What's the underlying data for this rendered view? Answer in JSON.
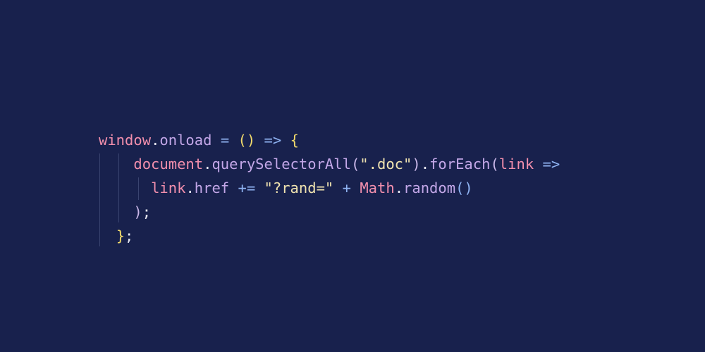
{
  "theme": {
    "background": "#18214d",
    "guide": "#3a4470"
  },
  "code": {
    "lines": [
      [
        {
          "t": "window",
          "c": "var"
        },
        {
          "t": ".",
          "c": "dot"
        },
        {
          "t": "onload",
          "c": "prop"
        },
        {
          "t": " ",
          "c": "ws"
        },
        {
          "t": "=",
          "c": "op"
        },
        {
          "t": " ",
          "c": "ws"
        },
        {
          "t": "()",
          "c": "paren"
        },
        {
          "t": " ",
          "c": "ws"
        },
        {
          "t": "=>",
          "c": "op"
        },
        {
          "t": " ",
          "c": "ws"
        },
        {
          "t": "{",
          "c": "brace"
        }
      ],
      [
        {
          "t": "    ",
          "c": "ws"
        },
        {
          "t": "document",
          "c": "var"
        },
        {
          "t": ".",
          "c": "dot"
        },
        {
          "t": "querySelectorAll",
          "c": "prop"
        },
        {
          "t": "(",
          "c": "punct"
        },
        {
          "t": "\".doc\"",
          "c": "str"
        },
        {
          "t": ")",
          "c": "punct"
        },
        {
          "t": ".",
          "c": "dot"
        },
        {
          "t": "forEach",
          "c": "prop"
        },
        {
          "t": "(",
          "c": "punct"
        },
        {
          "t": "link",
          "c": "var"
        },
        {
          "t": " ",
          "c": "ws"
        },
        {
          "t": "=>",
          "c": "op"
        }
      ],
      [
        {
          "t": "      ",
          "c": "ws"
        },
        {
          "t": "link",
          "c": "var"
        },
        {
          "t": ".",
          "c": "dot"
        },
        {
          "t": "href",
          "c": "prop"
        },
        {
          "t": " ",
          "c": "ws"
        },
        {
          "t": "+=",
          "c": "op"
        },
        {
          "t": " ",
          "c": "ws"
        },
        {
          "t": "\"?rand=\"",
          "c": "str"
        },
        {
          "t": " ",
          "c": "ws"
        },
        {
          "t": "+",
          "c": "op"
        },
        {
          "t": " ",
          "c": "ws"
        },
        {
          "t": "Math",
          "c": "var"
        },
        {
          "t": ".",
          "c": "dot"
        },
        {
          "t": "random",
          "c": "prop"
        },
        {
          "t": "()",
          "c": "inner"
        }
      ],
      [
        {
          "t": "    ",
          "c": "ws"
        },
        {
          "t": ")",
          "c": "punct"
        },
        {
          "t": ";",
          "c": "dot"
        }
      ],
      [
        {
          "t": "  ",
          "c": "ws"
        },
        {
          "t": "}",
          "c": "brace"
        },
        {
          "t": ";",
          "c": "dot"
        }
      ]
    ]
  }
}
